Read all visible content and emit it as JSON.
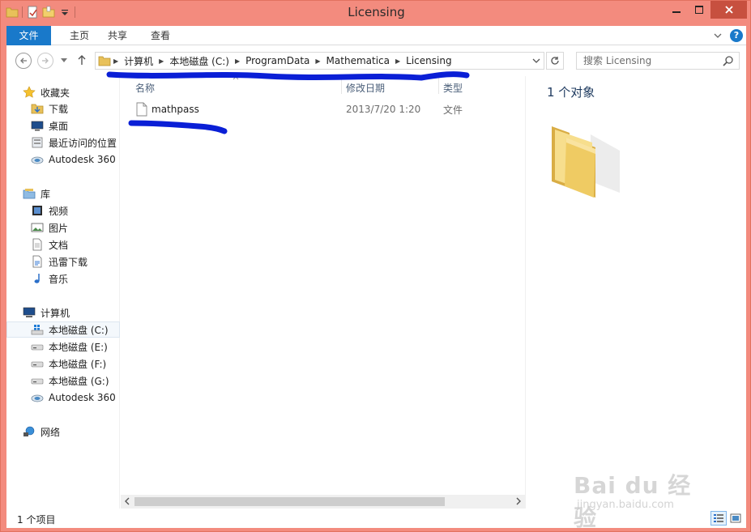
{
  "window": {
    "title": "Licensing"
  },
  "ribbon": {
    "tabs": [
      "文件",
      "主页",
      "共享",
      "查看"
    ]
  },
  "address": {
    "crumbs": [
      "计算机",
      "本地磁盘 (C:)",
      "ProgramData",
      "Mathematica",
      "Licensing"
    ]
  },
  "search": {
    "placeholder": "搜索 Licensing"
  },
  "nav": {
    "favorites": {
      "label": "收藏夹",
      "items": [
        "下载",
        "桌面",
        "最近访问的位置",
        "Autodesk 360"
      ]
    },
    "libraries": {
      "label": "库",
      "items": [
        "视频",
        "图片",
        "文档",
        "迅雷下载",
        "音乐"
      ]
    },
    "computer": {
      "label": "计算机",
      "items": [
        "本地磁盘 (C:)",
        "本地磁盘 (E:)",
        "本地磁盘 (F:)",
        "本地磁盘 (G:)",
        "Autodesk 360"
      ]
    },
    "network": {
      "label": "网络"
    }
  },
  "columns": {
    "name": "名称",
    "date": "修改日期",
    "type": "类型"
  },
  "files": [
    {
      "name": "mathpass",
      "date": "2013/7/20 1:20",
      "type": "文件"
    }
  ],
  "preview": {
    "count_label": "1 个对象"
  },
  "status": {
    "text": "1 个项目"
  },
  "watermark": {
    "brand": "Bai du 经验",
    "url": "jingyan.baidu.com"
  },
  "colors": {
    "accent": "#1979ca",
    "frame": "#f38b7e",
    "close": "#c7503f",
    "marker": "#0a1fd6"
  },
  "icons": {
    "qat": [
      "folder-icon",
      "properties-icon",
      "new-folder-icon",
      "qat-dropdown-icon"
    ],
    "nav_favorites": [
      "star-icon",
      "download-folder-icon",
      "desktop-icon",
      "recent-places-icon",
      "cloud-icon"
    ],
    "nav_libraries": [
      "library-icon",
      "video-icon",
      "picture-icon",
      "document-icon",
      "thunder-download-icon",
      "music-icon"
    ]
  }
}
